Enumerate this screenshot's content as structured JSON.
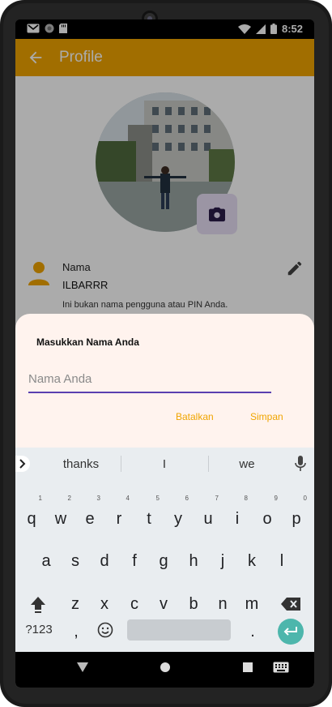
{
  "status_bar": {
    "time": "8:52"
  },
  "app_bar": {
    "title": "Profile"
  },
  "profile": {
    "name_label": "Nama",
    "name_value": "ILBARRR",
    "name_hint": "Ini bukan nama pengguna atau PIN Anda."
  },
  "dialog": {
    "title": "Masukkan Nama Anda",
    "input_placeholder": "Nama Anda",
    "input_value": "",
    "cancel_label": "Batalkan",
    "save_label": "Simpan"
  },
  "keyboard": {
    "suggestions": [
      "thanks",
      "I",
      "we"
    ],
    "row1": [
      "q",
      "w",
      "e",
      "r",
      "t",
      "y",
      "u",
      "i",
      "o",
      "p"
    ],
    "row1_hints": [
      "1",
      "2",
      "3",
      "4",
      "5",
      "6",
      "7",
      "8",
      "9",
      "0"
    ],
    "row2": [
      "a",
      "s",
      "d",
      "f",
      "g",
      "h",
      "j",
      "k",
      "l"
    ],
    "row3": [
      "z",
      "x",
      "c",
      "v",
      "b",
      "n",
      "m"
    ],
    "symbols_label": "?123",
    "comma": ",",
    "period": "."
  },
  "colors": {
    "app_bar": "#f0a500",
    "accent_button": "#f0a500",
    "input_underline": "#5a3fb0",
    "enter_key": "#4db6ac"
  }
}
